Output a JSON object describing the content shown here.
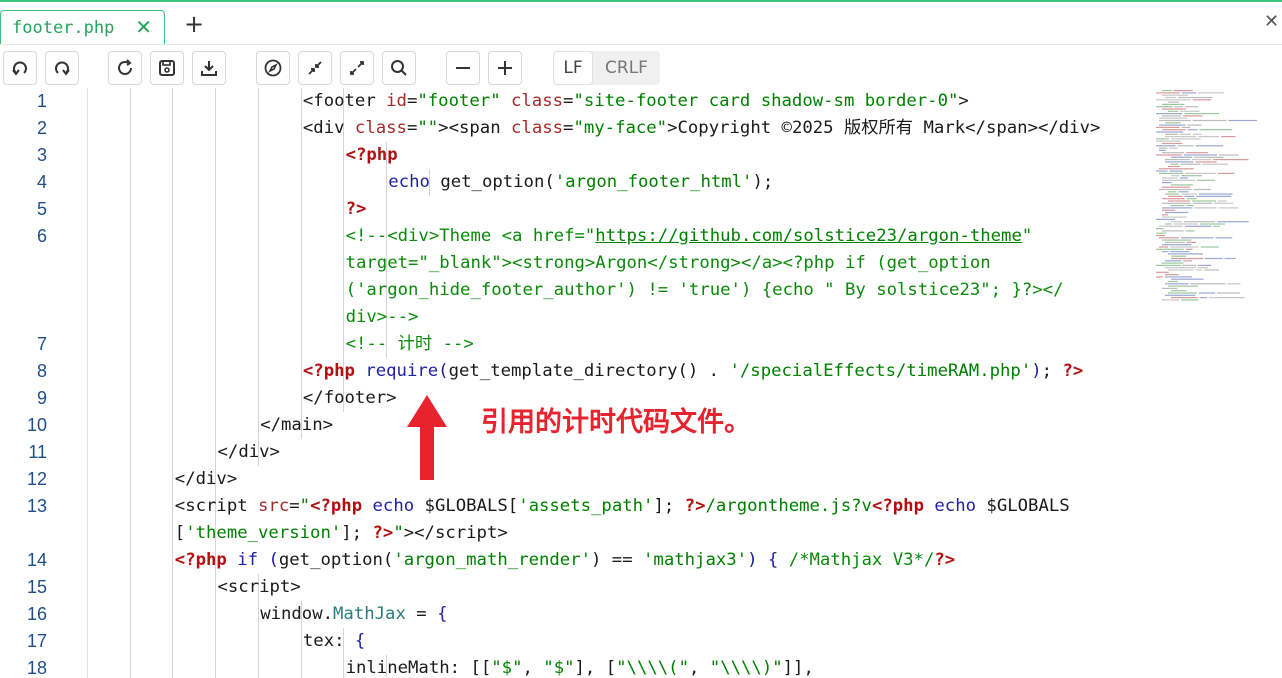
{
  "tab": {
    "filename": "footer.php",
    "close_symbol": "✕",
    "new_tab_symbol": "+"
  },
  "window": {
    "close_symbol": "✕"
  },
  "toolbar": {
    "buttons": [
      "undo-icon",
      "redo-icon",
      "reload-icon",
      "save-icon",
      "download-icon",
      "compass-icon",
      "collapse-icon",
      "expand-icon",
      "search-icon",
      "zoom-out-icon",
      "zoom-in-icon"
    ],
    "eol_options": [
      "LF",
      "CRLF"
    ],
    "eol_selected": "LF"
  },
  "editor": {
    "lines": [
      {
        "num": "1",
        "indent": 7,
        "tokens": [
          [
            "t-br",
            "<"
          ],
          [
            "t-tag",
            "footer"
          ],
          [
            "t-plain",
            " "
          ],
          [
            "t-attr",
            "id"
          ],
          [
            "t-plain",
            "="
          ],
          [
            "t-str",
            "\"footer\""
          ],
          [
            "t-plain",
            " "
          ],
          [
            "t-attr",
            "class"
          ],
          [
            "t-plain",
            "="
          ],
          [
            "t-str",
            "\"site-footer card shadow-sm border-0\""
          ],
          [
            "t-br",
            ">"
          ]
        ]
      },
      {
        "num": "2",
        "indent": 7,
        "tokens": [
          [
            "t-br",
            "<"
          ],
          [
            "t-tag",
            "div"
          ],
          [
            "t-plain",
            " "
          ],
          [
            "t-attr",
            "class"
          ],
          [
            "t-plain",
            "="
          ],
          [
            "t-str",
            "\"\""
          ],
          [
            "t-br",
            "><"
          ],
          [
            "t-tag",
            "span"
          ],
          [
            "t-plain",
            " "
          ],
          [
            "t-attr",
            "class"
          ],
          [
            "t-plain",
            "="
          ],
          [
            "t-str",
            "\"my-face\""
          ],
          [
            "t-br",
            ">"
          ],
          [
            "t-plain",
            "Copyright ©2025 版权所有 Mark"
          ],
          [
            "t-br",
            "</"
          ],
          [
            "t-tag",
            "span"
          ],
          [
            "t-br",
            "></"
          ],
          [
            "t-tag",
            "div"
          ],
          [
            "t-br",
            ">"
          ]
        ]
      },
      {
        "num": "3",
        "indent": 8,
        "tokens": [
          [
            "t-php",
            "<?php"
          ]
        ]
      },
      {
        "num": "4",
        "indent": 9,
        "tokens": [
          [
            "t-kw",
            "echo"
          ],
          [
            "t-plain",
            " get_option("
          ],
          [
            "t-str",
            "'argon_footer_html'"
          ],
          [
            "t-plain",
            ");"
          ]
        ]
      },
      {
        "num": "5",
        "indent": 8,
        "tokens": [
          [
            "t-php",
            "?>"
          ]
        ]
      },
      {
        "num": "6",
        "indent": 8,
        "tokens": [
          [
            "t-comment",
            "<!--<div>Theme <a href=\""
          ],
          [
            "t-url",
            "https://github.com/solstice23/argon-theme"
          ],
          [
            "t-comment",
            "\""
          ]
        ]
      },
      {
        "num": "",
        "indent": 8,
        "tokens": [
          [
            "t-comment",
            "target=\"_blank\"><strong>Argon</strong></a><?php if (get_option"
          ]
        ]
      },
      {
        "num": "",
        "indent": 8,
        "tokens": [
          [
            "t-comment",
            "('argon_hide_footer_author') != 'true') {echo \" By solstice23\"; }?></"
          ]
        ]
      },
      {
        "num": "",
        "indent": 8,
        "tokens": [
          [
            "t-comment",
            "div>-->"
          ]
        ]
      },
      {
        "num": "7",
        "indent": 8,
        "tokens": [
          [
            "t-comment",
            "<!-- 计时 -->"
          ]
        ]
      },
      {
        "num": "8",
        "indent": 7,
        "tokens": [
          [
            "t-php",
            "<?php"
          ],
          [
            "t-plain",
            " "
          ],
          [
            "t-kw",
            "require"
          ],
          [
            "t-paren",
            "("
          ],
          [
            "t-plain",
            "get_template_directory() . "
          ],
          [
            "t-str",
            "'/specialEffects/timeRAM.php'"
          ],
          [
            "t-paren",
            ")"
          ],
          [
            "t-plain",
            "; "
          ],
          [
            "t-php",
            "?>"
          ]
        ]
      },
      {
        "num": "9",
        "indent": 7,
        "tokens": [
          [
            "t-br",
            "</"
          ],
          [
            "t-tag",
            "footer"
          ],
          [
            "t-br",
            ">"
          ]
        ]
      },
      {
        "num": "10",
        "indent": 6,
        "tokens": [
          [
            "t-br",
            "</"
          ],
          [
            "t-tag",
            "main"
          ],
          [
            "t-br",
            ">"
          ]
        ]
      },
      {
        "num": "11",
        "indent": 5,
        "tokens": [
          [
            "t-br",
            "</"
          ],
          [
            "t-tag",
            "div"
          ],
          [
            "t-br",
            ">"
          ]
        ]
      },
      {
        "num": "12",
        "indent": 4,
        "tokens": [
          [
            "t-br",
            "</"
          ],
          [
            "t-tag",
            "div"
          ],
          [
            "t-br",
            ">"
          ]
        ]
      },
      {
        "num": "13",
        "indent": 4,
        "tokens": [
          [
            "t-br",
            "<"
          ],
          [
            "t-tag",
            "script"
          ],
          [
            "t-plain",
            " "
          ],
          [
            "t-attr",
            "src"
          ],
          [
            "t-plain",
            "="
          ],
          [
            "t-str",
            "\""
          ],
          [
            "t-php",
            "<?php"
          ],
          [
            "t-plain",
            " "
          ],
          [
            "t-kw",
            "echo"
          ],
          [
            "t-plain",
            " $GLOBALS["
          ],
          [
            "t-str",
            "'assets_path'"
          ],
          [
            "t-plain",
            "]; "
          ],
          [
            "t-php",
            "?>"
          ],
          [
            "t-str",
            "/argontheme.js?v"
          ],
          [
            "t-php",
            "<?php"
          ],
          [
            "t-plain",
            " "
          ],
          [
            "t-kw",
            "echo"
          ],
          [
            "t-plain",
            " $GLOBALS"
          ]
        ]
      },
      {
        "num": "",
        "indent": 4,
        "tokens": [
          [
            "t-plain",
            "["
          ],
          [
            "t-str",
            "'theme_version'"
          ],
          [
            "t-plain",
            "]; "
          ],
          [
            "t-php",
            "?>"
          ],
          [
            "t-str",
            "\""
          ],
          [
            "t-br",
            "></"
          ],
          [
            "t-tag",
            "script"
          ],
          [
            "t-br",
            ">"
          ]
        ]
      },
      {
        "num": "14",
        "indent": 4,
        "tokens": [
          [
            "t-php",
            "<?php"
          ],
          [
            "t-plain",
            " "
          ],
          [
            "t-kw",
            "if"
          ],
          [
            "t-plain",
            " "
          ],
          [
            "t-paren",
            "("
          ],
          [
            "t-plain",
            "get_option("
          ],
          [
            "t-str",
            "'argon_math_render'"
          ],
          [
            "t-plain",
            ") == "
          ],
          [
            "t-str",
            "'mathjax3'"
          ],
          [
            "t-paren",
            ")"
          ],
          [
            "t-plain",
            " "
          ],
          [
            "t-kw",
            "{"
          ],
          [
            "t-plain",
            " "
          ],
          [
            "t-comment",
            "/*Mathjax V3*/"
          ],
          [
            "t-php",
            "?>"
          ]
        ]
      },
      {
        "num": "15",
        "indent": 5,
        "tokens": [
          [
            "t-br",
            "<"
          ],
          [
            "t-tag",
            "script"
          ],
          [
            "t-br",
            ">"
          ]
        ]
      },
      {
        "num": "16",
        "indent": 6,
        "tokens": [
          [
            "t-plain",
            "window."
          ],
          [
            "t-cls",
            "MathJax"
          ],
          [
            "t-plain",
            " = "
          ],
          [
            "t-kw",
            "{"
          ]
        ]
      },
      {
        "num": "17",
        "indent": 7,
        "tokens": [
          [
            "t-prop",
            "tex"
          ],
          [
            "t-plain",
            ": "
          ],
          [
            "t-kw",
            "{"
          ]
        ]
      },
      {
        "num": "18",
        "indent": 8,
        "tokens": [
          [
            "t-prop",
            "inlineMath"
          ],
          [
            "t-plain",
            ": [["
          ],
          [
            "t-str",
            "\"$\""
          ],
          [
            "t-plain",
            ", "
          ],
          [
            "t-str",
            "\"$\""
          ],
          [
            "t-plain",
            "], ["
          ],
          [
            "t-str",
            "\"\\\\\\\\(\""
          ],
          [
            "t-plain",
            ", "
          ],
          [
            "t-str",
            "\"\\\\\\\\)\""
          ],
          [
            "t-plain",
            "]],"
          ]
        ]
      }
    ]
  },
  "annotation": {
    "text": "引用的计时代码文件。",
    "color": "#e8232d"
  },
  "colors": {
    "accent": "#3cc47c",
    "tab_text": "#27a35c",
    "line_number": "#1e4f8c"
  }
}
